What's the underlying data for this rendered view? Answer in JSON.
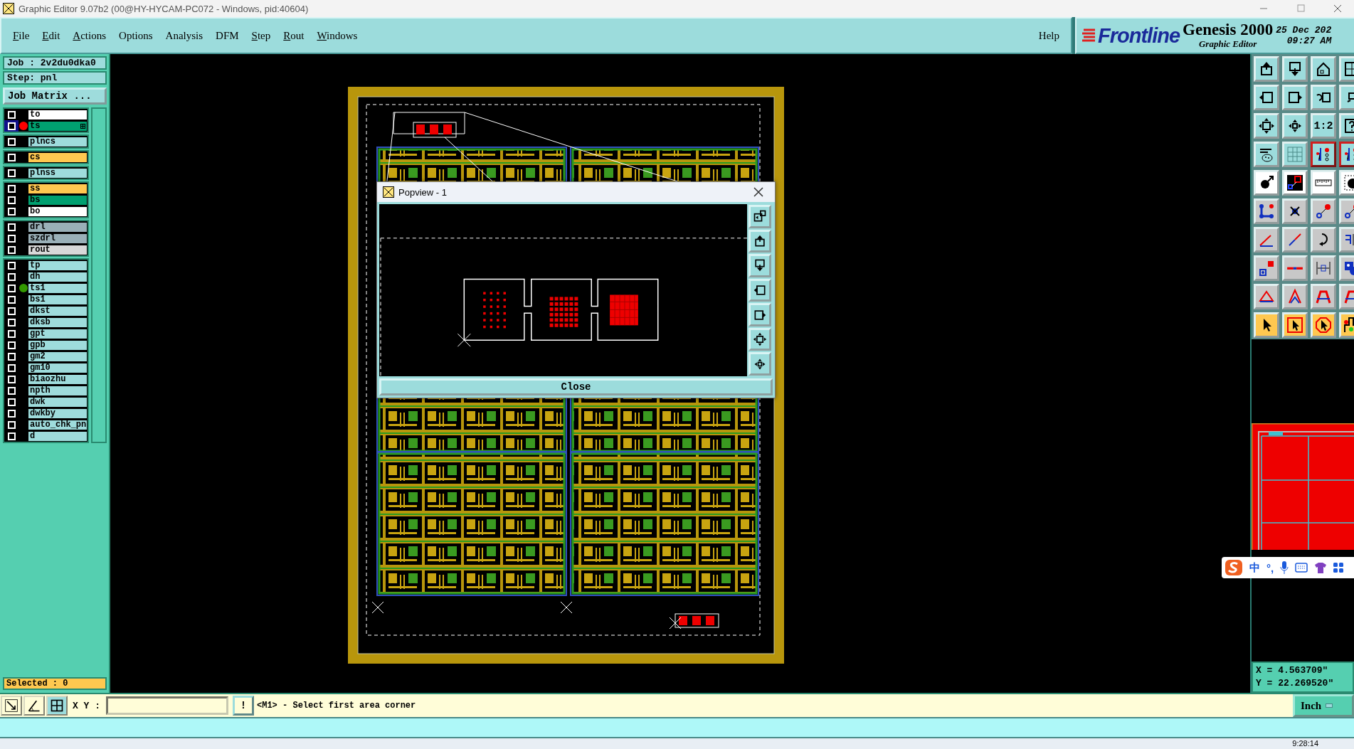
{
  "window": {
    "title": "Graphic Editor 9.07b2 (00@HY-HYCAM-PC072 - Windows, pid:40604)"
  },
  "menu": [
    {
      "label": "File",
      "underline": true
    },
    {
      "label": "Edit",
      "underline": true
    },
    {
      "label": "Actions",
      "underline": true
    },
    {
      "label": "Options",
      "underline": false
    },
    {
      "label": "Analysis",
      "underline": false
    },
    {
      "label": "DFM",
      "underline": false
    },
    {
      "label": "Step",
      "underline": true
    },
    {
      "label": "Rout",
      "underline": true
    },
    {
      "label": "Windows",
      "underline": true
    }
  ],
  "help": "Help",
  "logo": {
    "brand": "Frontline",
    "product": "Genesis 2000",
    "subtitle": "Graphic Editor",
    "date": "25 Dec 202",
    "time": "09:27 AM"
  },
  "job": {
    "job": "Job : 2v2du0dka0",
    "step": "Step: pnl",
    "matrix_button": "Job Matrix ..."
  },
  "layer_groups": [
    {
      "layers": [
        {
          "name": "to",
          "color": "#ffffff",
          "work": false
        },
        {
          "name": "ts",
          "color": "#00a070",
          "work": true,
          "sub": true,
          "marker": {
            "color": "#ff0000"
          }
        }
      ]
    },
    {
      "layers": [
        {
          "name": "plncs",
          "color": "#9edcdc",
          "work": false
        }
      ]
    },
    {
      "layers": [
        {
          "name": "cs",
          "color": "#ffc850",
          "work": false
        }
      ]
    },
    {
      "layers": [
        {
          "name": "plnss",
          "color": "#9edcdc",
          "work": false
        }
      ]
    },
    {
      "layers": [
        {
          "name": "ss",
          "color": "#ffc850",
          "work": false
        },
        {
          "name": "bs",
          "color": "#00a070",
          "work": false
        },
        {
          "name": "bo",
          "color": "#ffffff",
          "work": false
        }
      ]
    },
    {
      "layers": [
        {
          "name": "drl",
          "color": "#9ab0b8",
          "work": false
        },
        {
          "name": "szdrl",
          "color": "#9ab0b8",
          "work": false
        },
        {
          "name": "rout",
          "color": "#d8d8d8",
          "work": false
        }
      ]
    },
    {
      "layers": [
        {
          "name": "tp",
          "color": "#9edcdc",
          "work": false
        },
        {
          "name": "dh",
          "color": "#9edcdc",
          "work": false
        },
        {
          "name": "ts1",
          "color": "#9edcdc",
          "work": false,
          "marker": {
            "color": "#339900"
          }
        },
        {
          "name": "bs1",
          "color": "#9edcdc",
          "work": false
        },
        {
          "name": "dkst",
          "color": "#9edcdc",
          "work": false
        },
        {
          "name": "dksb",
          "color": "#9edcdc",
          "work": false
        },
        {
          "name": "gpt",
          "color": "#9edcdc",
          "work": false
        },
        {
          "name": "gpb",
          "color": "#9edcdc",
          "work": false
        },
        {
          "name": "gm2",
          "color": "#9edcdc",
          "work": false
        },
        {
          "name": "gm10",
          "color": "#9edcdc",
          "work": false
        },
        {
          "name": "biaozhu",
          "color": "#9edcdc",
          "work": false
        },
        {
          "name": "npth",
          "color": "#9edcdc",
          "work": false
        },
        {
          "name": "dwk",
          "color": "#9edcdc",
          "work": false
        },
        {
          "name": "dwkby",
          "color": "#9edcdc",
          "work": false
        },
        {
          "name": "auto_chk_pn",
          "color": "#9edcdc",
          "work": false
        },
        {
          "name": "d",
          "color": "#9edcdc",
          "work": false
        }
      ]
    }
  ],
  "selected_count": "Selected : 0",
  "toolbar": [
    [
      {
        "kind": "view"
      },
      {
        "kind": "view"
      },
      {
        "kind": "view"
      },
      {
        "kind": "view"
      }
    ],
    [
      {
        "kind": "view"
      },
      {
        "kind": "view"
      },
      {
        "kind": "view"
      },
      {
        "kind": "view"
      }
    ],
    [
      {
        "kind": "view"
      },
      {
        "kind": "view"
      },
      {
        "kind": "view",
        "label": "1:2"
      },
      {
        "kind": "view"
      }
    ],
    [
      {
        "kind": "view"
      },
      {
        "kind": "view"
      },
      {
        "kind": "layer"
      },
      {
        "kind": "layer"
      }
    ],
    [
      {
        "kind": "white"
      },
      {
        "kind": "dark"
      },
      {
        "kind": "white"
      },
      {
        "kind": "white"
      }
    ],
    [
      {
        "kind": "edit"
      },
      {
        "kind": "edit"
      },
      {
        "kind": "edit"
      },
      {
        "kind": "edit"
      }
    ],
    [
      {
        "kind": "edit"
      },
      {
        "kind": "edit"
      },
      {
        "kind": "edit"
      },
      {
        "kind": "edit"
      }
    ],
    [
      {
        "kind": "edit"
      },
      {
        "kind": "edit"
      },
      {
        "kind": "edit"
      },
      {
        "kind": "edit"
      }
    ],
    [
      {
        "kind": "edit"
      },
      {
        "kind": "edit"
      },
      {
        "kind": "edit"
      },
      {
        "kind": "edit"
      }
    ],
    [
      {
        "kind": "select"
      },
      {
        "kind": "select"
      },
      {
        "kind": "select"
      },
      {
        "kind": "select"
      }
    ]
  ],
  "popview": {
    "title": "Popview - 1",
    "close_button": "Close"
  },
  "coordinates": {
    "x": "X = 4.563709\"",
    "y": "Y = 22.269520\""
  },
  "command": {
    "tools": [
      {
        "selected": false
      },
      {
        "selected": false
      },
      {
        "selected": true
      }
    ],
    "xy_label": "X Y :",
    "confirm": "!",
    "prompt": "<M1> - Select first area corner",
    "units": "Inch"
  },
  "ime": {
    "mode": "中",
    "punctuation": "°,"
  },
  "taskbar": {
    "clock": "9:28:14"
  }
}
